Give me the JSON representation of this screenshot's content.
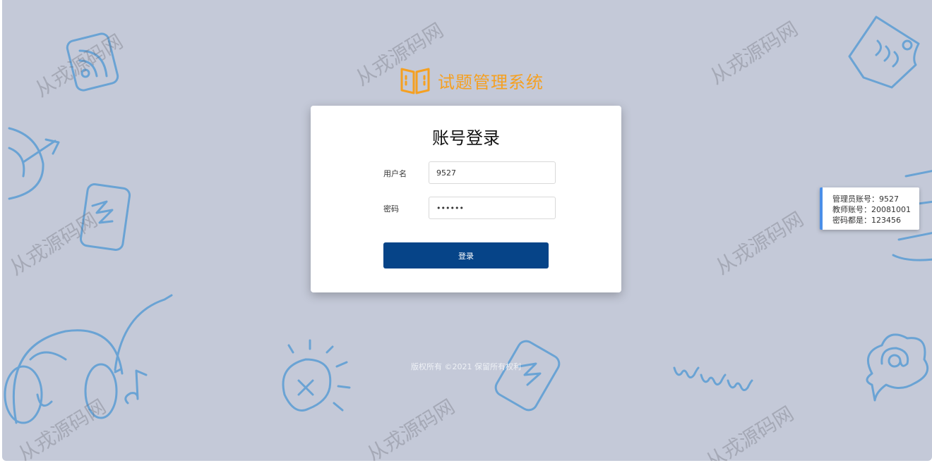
{
  "app": {
    "title": "试题管理系统",
    "brand_color": "#f5a021",
    "logo_icon": "open-book-icon"
  },
  "login": {
    "heading": "账号登录",
    "username_label": "用户名",
    "username_value": "9527",
    "password_label": "密码",
    "password_value": "123456",
    "submit_label": "登录",
    "button_color": "#064488"
  },
  "tip": {
    "lines": [
      "管理员账号：9527",
      "教师账号：20081001",
      "密码都是：123456"
    ]
  },
  "footer": {
    "copyright": "版权所有 ©2021 保留所有权利"
  },
  "watermark": {
    "text": "从戎源码网"
  },
  "background": {
    "color": "#c4c9d8",
    "doodle_color": "#6aa3d4",
    "doodles": [
      "rss-icon",
      "globe-icon",
      "phone-icon",
      "headphones-icon",
      "music-note-icon",
      "lightbulb-icon",
      "www-icon",
      "at-cloud-icon",
      "document-icon",
      "laptop-icon"
    ]
  }
}
